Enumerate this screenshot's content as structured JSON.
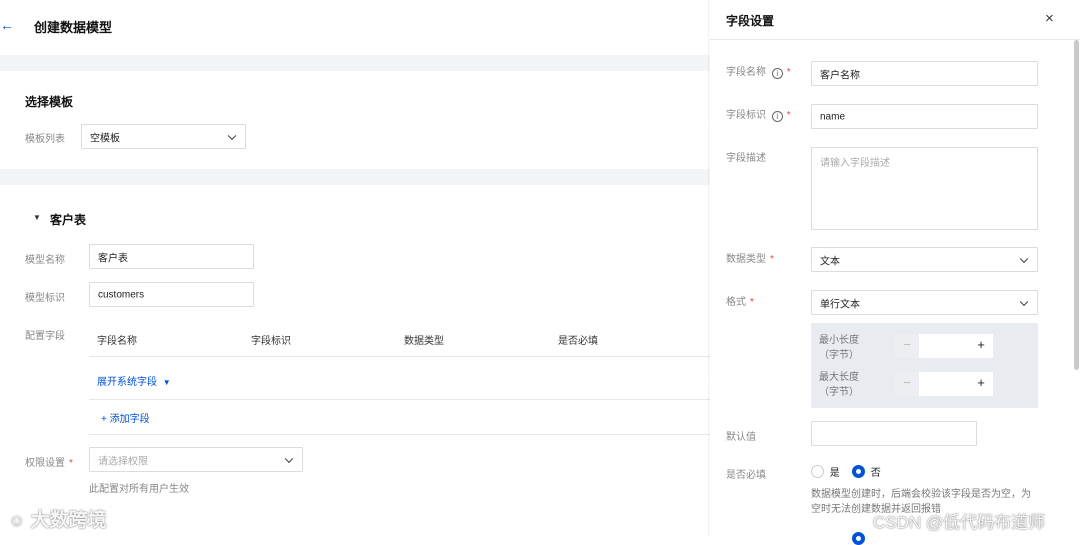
{
  "header": {
    "back_icon": "arrow-left-icon",
    "title": "创建数据模型"
  },
  "template_section": {
    "title": "选择模板",
    "list_label": "模板列表",
    "selected": "空模板"
  },
  "table_section": {
    "title": "客户表",
    "model_name_label": "模型名称",
    "model_name_value": "客户表",
    "model_id_label": "模型标识",
    "model_id_value": "customers",
    "config_fields_label": "配置字段",
    "columns": [
      "字段名称",
      "字段标识",
      "数据类型",
      "是否必填"
    ],
    "expand_system_fields": "展开系统字段",
    "add_field": "+ 添加字段",
    "permission_label": "权限设置",
    "permission_placeholder": "请选择权限",
    "permission_hint": "此配置对所有用户生效"
  },
  "panel": {
    "title": "字段设置",
    "field_name_label": "字段名称",
    "field_name_value": "客户名称",
    "field_id_label": "字段标识",
    "field_id_value": "name",
    "field_desc_label": "字段描述",
    "field_desc_placeholder": "请输入字段描述",
    "data_type_label": "数据类型",
    "data_type_value": "文本",
    "format_label": "格式",
    "format_value": "单行文本",
    "min_len_label_1": "最小长度",
    "min_len_label_2": "（字节）",
    "max_len_label_1": "最大长度",
    "max_len_label_2": "（字节）",
    "stepper_minus": "−",
    "stepper_plus": "+",
    "default_label": "默认值",
    "required_label": "是否必填",
    "required_yes": "是",
    "required_no": "否",
    "required_selected": "否",
    "required_hint_1": "数据模型创建时，后端会校验该字段是否为空，为",
    "required_hint_2": "空时无法创建数据并返回报错"
  },
  "watermarks": {
    "left": "大数跨境",
    "right": "CSDN @低代码布道师"
  },
  "colors": {
    "accent": "#0052d9",
    "required": "#e54545",
    "divider": "#f3f4f6"
  }
}
